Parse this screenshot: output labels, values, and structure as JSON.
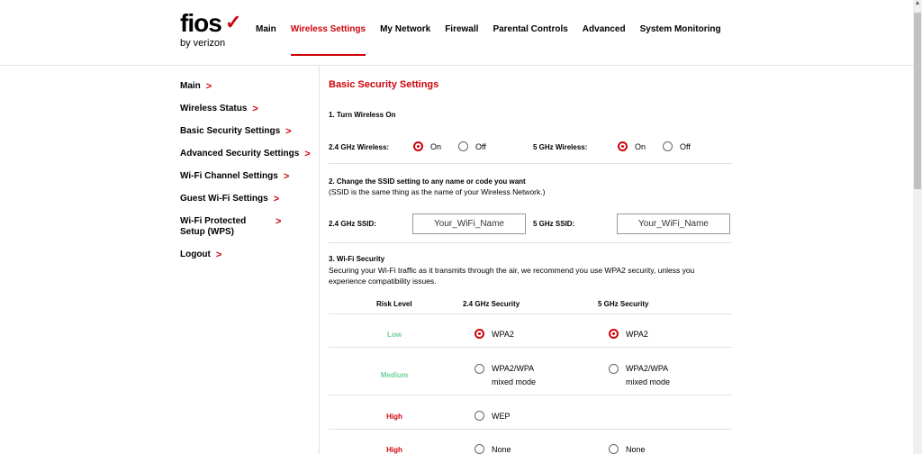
{
  "logo": {
    "word": "fios",
    "sub": "by verizon",
    "check": "✓"
  },
  "topnav": [
    "Main",
    "Wireless Settings",
    "My Network",
    "Firewall",
    "Parental Controls",
    "Advanced",
    "System Monitoring"
  ],
  "topnav_active": "Wireless Settings",
  "sidebar": [
    "Main",
    "Wireless Status",
    "Basic Security Settings",
    "Advanced Security Settings",
    "Wi-Fi Channel Settings",
    "Guest Wi-Fi Settings",
    "Wi-Fi Protected Setup (WPS)",
    "Logout"
  ],
  "page_title": "Basic Security Settings",
  "section1": {
    "title": "1. Turn Wireless On",
    "label_24": "2.4 GHz Wireless:",
    "label_5": "5 GHz Wireless:",
    "on": "On",
    "off": "Off",
    "selected_24": "On",
    "selected_5": "On"
  },
  "section2": {
    "title": "2. Change the SSID setting to any name or code you want",
    "note": "(SSID is the same thing as the name of your Wireless Network.)",
    "label_24": "2.4 GHz SSID:",
    "label_5": "5 GHz SSID:",
    "ssid_24": "Your_WiFi_Name",
    "ssid_5": "Your_WiFi_Name"
  },
  "section3": {
    "title": "3. Wi-Fi Security",
    "note": "Securing your Wi-Fi traffic as it transmits through the air, we recommend you use WPA2 security, unless you experience compatibility issues.",
    "col_risk": "Risk Level",
    "col_24": "2.4 GHz Security",
    "col_5": "5 GHz Security",
    "rows": [
      {
        "risk": "Low",
        "opt_24": "WPA2",
        "opt_5": "WPA2",
        "sel_24": true,
        "sel_5": true
      },
      {
        "risk": "Medium",
        "opt_24": "WPA2/WPA",
        "opt_24_line2": "mixed mode",
        "opt_5": "WPA2/WPA",
        "opt_5_line2": "mixed mode"
      },
      {
        "risk": "High",
        "opt_24": "WEP"
      },
      {
        "risk": "High",
        "opt_24": "None",
        "opt_5": "None"
      }
    ]
  },
  "colors": {
    "accent": "#cd040b",
    "risk_low": "#6fcf97"
  }
}
